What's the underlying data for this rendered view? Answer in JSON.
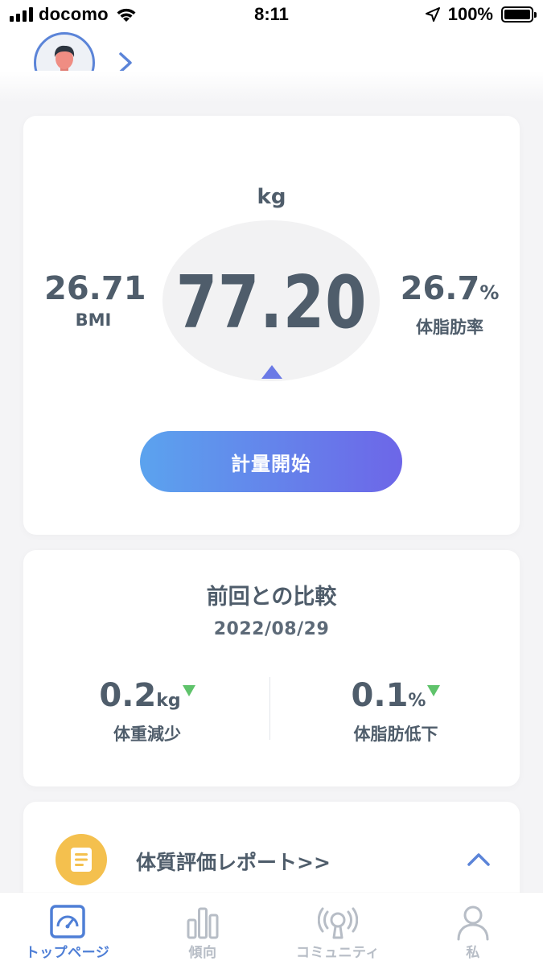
{
  "status_bar": {
    "carrier": "docomo",
    "time": "8:11",
    "battery_percent": "100%"
  },
  "header": {
    "avatar_icon": "user-avatar-icon",
    "chevron_icon": "chevron-right-icon"
  },
  "measurement": {
    "unit": "kg",
    "weight": "77.20",
    "bmi_value": "26.71",
    "bmi_label": "BMI",
    "body_fat_value": "26.7",
    "body_fat_unit": "%",
    "body_fat_label": "体脂肪率",
    "start_button": "計量開始"
  },
  "comparison": {
    "title": "前回との比較",
    "date": "2022/08/29",
    "weight_change": {
      "value": "0.2",
      "unit": "kg",
      "label": "体重減少"
    },
    "fat_change": {
      "value": "0.1",
      "unit": "%",
      "label": "体脂肪低下"
    }
  },
  "report": {
    "icon": "document-icon",
    "title": "体質評価レポート>>",
    "toggle_icon": "chevron-up-icon"
  },
  "tabs": [
    {
      "label": "トップページ",
      "icon": "gauge-icon",
      "active": true
    },
    {
      "label": "傾向",
      "icon": "bar-chart-icon",
      "active": false
    },
    {
      "label": "コミュニティ",
      "icon": "broadcast-icon",
      "active": false
    },
    {
      "label": "私",
      "icon": "person-icon",
      "active": false
    }
  ],
  "colors": {
    "accent": "#5b84d8",
    "button_start": "#5ba3ee",
    "button_end": "#6d66e8",
    "decrease_indicator": "#5fc36b",
    "report_icon_bg": "#f4c04e",
    "text_primary": "#4f5d6b"
  }
}
